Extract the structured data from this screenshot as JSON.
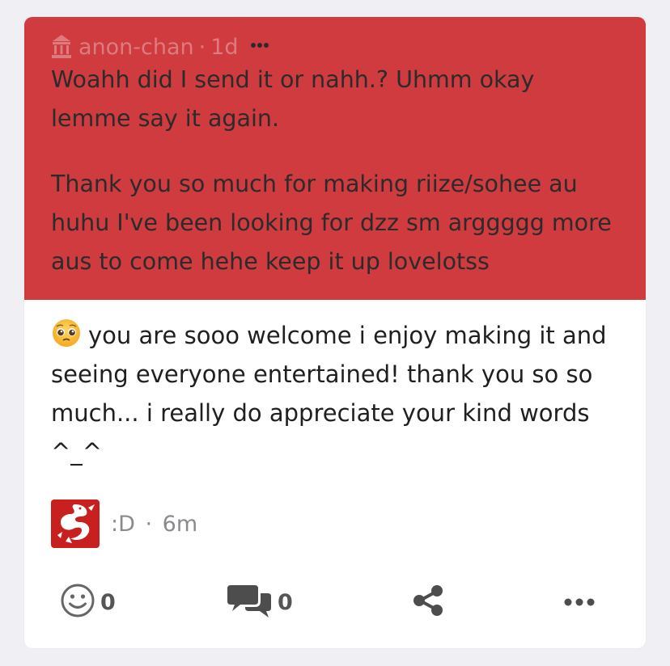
{
  "ask": {
    "author": "anon-chan",
    "separator": "·",
    "time": "1d",
    "more_icon": "ellipsis-icon",
    "paragraph_1": "Woahh did I send it or nahh.? Uhmm okay lemme say it again.",
    "paragraph_2": "Thank you so much for making riize/sohee au huhu I've been looking for dzz sm arggggg more aus to come hehe keep it up lovelotss",
    "background_color": "#cf3b3f"
  },
  "answer": {
    "emoji": "pleading-face-emoji",
    "text": "you are sooo welcome i enjoy making it and seeing everyone entertained! thank you so so much... i really do appreciate your kind words ^_^"
  },
  "replier": {
    "name": ":D",
    "separator": "·",
    "time": "6m",
    "avatar_icon": "white-dragon-on-red-avatar"
  },
  "actions": {
    "like_count": "0",
    "reply_count": "0",
    "like_icon": "smiley-icon",
    "reply_icon": "speech-bubbles-icon",
    "share_icon": "share-icon",
    "more_icon": "ellipsis-icon"
  }
}
